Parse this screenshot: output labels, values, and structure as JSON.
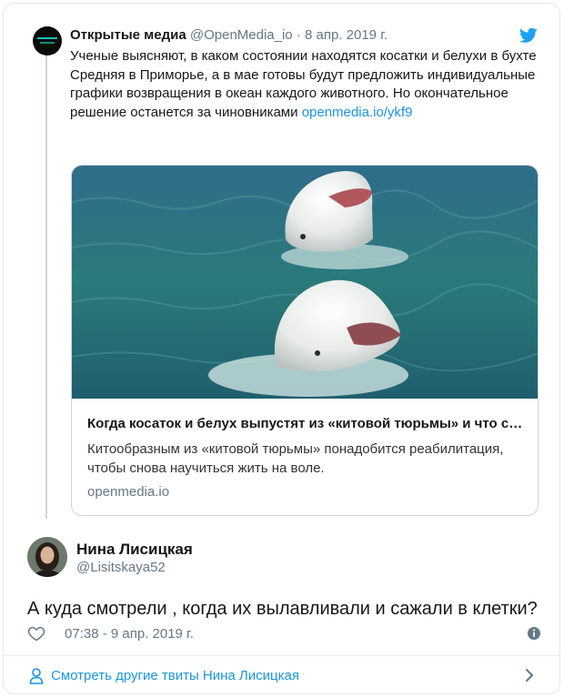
{
  "parent_tweet": {
    "author_name": "Открытые медиа",
    "author_handle": "@OpenMedia_io",
    "separator": "·",
    "date": "8 апр. 2019 г.",
    "text": "Ученые выясняют, в каком состоянии находятся косатки и белухи в бухте Средняя в Приморье, а в мае готовы будут предложить индивидуальные графики возвращения в океан каждого животного. Но окончательное решение останется за чиновниками",
    "link": "openmedia.io/ykf9",
    "card": {
      "title": "Когда косаток и белух выпустят из «китовой тюрьмы» и что с ними будет",
      "description": "Китообразным из «китовой тюрьмы» понадобится реабилитация, чтобы снова научиться жить на воле.",
      "domain": "openmedia.io"
    }
  },
  "reply_tweet": {
    "author_name": "Нина Лисицкая",
    "author_handle": "@Lisitskaya52",
    "text": "А куда смотрели , когда их вылавливали и сажали в клетки?",
    "timestamp": "07:38 - 9 апр. 2019 г."
  },
  "footer": {
    "more_tweets_label": "Смотреть другие твиты Нина Лисицкая"
  },
  "icons": {
    "brand": "twitter-bird-icon",
    "like": "heart-icon",
    "info": "info-icon",
    "profile": "person-icon",
    "navigate": "chevron-right-icon"
  },
  "colors": {
    "link_blue": "#1b95e0",
    "secondary_text": "#657786",
    "primary_text": "#14171a",
    "border": "#e1e8ed"
  }
}
